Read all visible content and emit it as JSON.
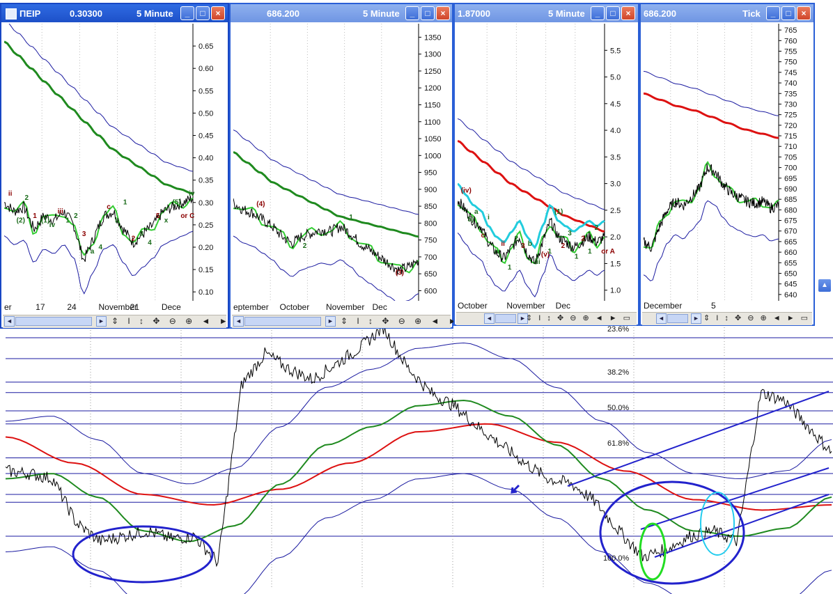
{
  "colors": {
    "blue_band": "#1a1aa0",
    "red_ma": "#dd1111",
    "green_ma": "#1f8a1f",
    "light_green": "#33cc33",
    "cyan": "#22ccdd",
    "ellipse_blue": "#2222cc",
    "ellipse_green": "#22dd22",
    "ellipse_cyan": "#22ccee",
    "title_active": "#1d50c8",
    "title_inactive": "#7aa0e8"
  },
  "windows": [
    {
      "title_left": "ПΕΙΡ",
      "title_value": "0.30300",
      "interval": "5 Minute",
      "y_ticks": [
        "0.65",
        "0.60",
        "0.55",
        "0.50",
        "0.45",
        "0.40",
        "0.35",
        "0.30",
        "0.25",
        "0.20",
        "0.15",
        "0.10"
      ],
      "x_ticks": [
        "er",
        "17",
        "24",
        "November",
        "21",
        "Dece"
      ],
      "wave_labels": [
        "ii",
        "(2)",
        "2",
        "1",
        "(1)",
        "iv",
        "iii",
        "1",
        "2",
        "3",
        "a",
        "4",
        "c",
        "b",
        "1",
        "2",
        "3",
        "4",
        "5",
        "x",
        "(5)",
        "or C",
        "iv"
      ],
      "buttons": {
        "min": "_",
        "max": "□",
        "close": "×"
      }
    },
    {
      "title_value": "686.200",
      "interval": "5 Minute",
      "y_ticks": [
        "1350",
        "1300",
        "1250",
        "1200",
        "1150",
        "1100",
        "1050",
        "1000",
        "950",
        "900",
        "850",
        "800",
        "750",
        "700",
        "650",
        "600"
      ],
      "x_ticks": [
        "eptember",
        "October",
        "November",
        "Dec"
      ],
      "wave_labels": [
        "(4)",
        "2",
        "1",
        "(3)"
      ],
      "buttons": {
        "min": "_",
        "max": "□",
        "close": "×"
      }
    },
    {
      "title_value": "1.87000",
      "interval": "5 Minute",
      "y_ticks": [
        "5.5",
        "5.0",
        "4.5",
        "4.0",
        "3.5",
        "3.0",
        "2.5",
        "2.0",
        "1.5",
        "1.0"
      ],
      "x_ticks": [
        "October",
        "November",
        "Dec"
      ],
      "wave_labels": [
        "(iv)",
        "5)",
        "a",
        "c",
        "i",
        "iv",
        "ii",
        "1",
        "2",
        "3",
        "b",
        "iii",
        "(v)",
        "1",
        "(1)",
        "2",
        "3",
        "1",
        "2",
        "1",
        "2",
        "or A"
      ],
      "buttons": {
        "min": "_",
        "max": "□",
        "close": "×"
      }
    },
    {
      "title_value": "686.200",
      "interval": "Tick",
      "y_ticks": [
        "765",
        "760",
        "755",
        "750",
        "745",
        "740",
        "735",
        "730",
        "725",
        "720",
        "715",
        "710",
        "705",
        "700",
        "695",
        "690",
        "685",
        "680",
        "675",
        "670",
        "665",
        "660",
        "655",
        "650",
        "645",
        "640"
      ],
      "x_ticks": [
        "December",
        "5"
      ],
      "buttons": {
        "min": "_",
        "max": "□",
        "close": "×"
      }
    }
  ],
  "toolbar_glyphs": "⇕ I ↕ ✥ ⊖ ⊕ ◄ ► ▭",
  "main": {
    "fib_labels": [
      "23.6%",
      "38.2%",
      "50.0%",
      "61.8%",
      "100.0%"
    ]
  },
  "chart_data": [
    {
      "type": "line",
      "title": "ПΕΙΡ 0.30300 5 Minute",
      "x": [
        "er",
        "17",
        "24",
        "November",
        "21",
        "Dece"
      ],
      "ylim": [
        0.08,
        0.7
      ],
      "y_ticks": [
        0.65,
        0.6,
        0.55,
        0.5,
        0.45,
        0.4,
        0.35,
        0.3,
        0.25,
        0.2,
        0.15,
        0.1
      ],
      "series": [
        {
          "values": [
            0.3,
            0.28,
            0.29,
            0.24,
            0.27,
            0.26,
            0.28,
            0.25,
            0.17,
            0.22,
            0.27,
            0.28,
            0.24,
            0.21,
            0.23,
            0.25,
            0.28,
            0.29,
            0.3,
            0.31
          ]
        },
        {
          "values": [
            0.66,
            0.63,
            0.6,
            0.57,
            0.54,
            0.51,
            0.48,
            0.45,
            0.42,
            0.4,
            0.38,
            0.36,
            0.34,
            0.33,
            0.32
          ]
        }
      ]
    },
    {
      "type": "line",
      "title": "686.200 5 Minute",
      "x": [
        "eptember",
        "October",
        "November",
        "Dec"
      ],
      "ylim": [
        570,
        1390
      ],
      "y_ticks": [
        1350,
        1300,
        1250,
        1200,
        1150,
        1100,
        1050,
        1000,
        950,
        900,
        850,
        800,
        750,
        700,
        650,
        600
      ],
      "series": [
        {
          "values": [
            860,
            840,
            830,
            810,
            790,
            760,
            740,
            760,
            770,
            780,
            775,
            790,
            770,
            740,
            720,
            700,
            680,
            660,
            670,
            690
          ]
        },
        {
          "values": [
            1010,
            980,
            950,
            920,
            900,
            880,
            860,
            840,
            820,
            810,
            800,
            790,
            780,
            770,
            760
          ]
        }
      ]
    },
    {
      "type": "line",
      "title": "1.87000 5 Minute",
      "x": [
        "October",
        "November",
        "Dec"
      ],
      "ylim": [
        0.8,
        6.0
      ],
      "y_ticks": [
        5.5,
        5.0,
        4.5,
        4.0,
        3.5,
        3.0,
        2.5,
        2.0,
        1.5,
        1.0
      ],
      "series": [
        {
          "values": [
            2.7,
            2.5,
            2.3,
            2.2,
            1.9,
            1.7,
            1.6,
            1.8,
            2.0,
            1.7,
            1.5,
            1.9,
            2.3,
            2.0,
            1.9,
            1.8,
            1.9,
            2.0,
            1.9,
            2.0
          ]
        },
        {
          "values": [
            3.8,
            3.6,
            3.4,
            3.2,
            3.0,
            2.85,
            2.7,
            2.55,
            2.4,
            2.3,
            2.2,
            2.1
          ]
        }
      ]
    },
    {
      "type": "line",
      "title": "686.200 Tick",
      "x": [
        "December",
        "5"
      ],
      "ylim": [
        637,
        768
      ],
      "y_ticks": [
        765,
        760,
        755,
        750,
        745,
        740,
        735,
        730,
        725,
        720,
        715,
        710,
        705,
        700,
        695,
        690,
        685,
        680,
        675,
        670,
        665,
        660,
        655,
        650,
        645,
        640
      ],
      "series": [
        {
          "values": [
            665,
            662,
            672,
            680,
            684,
            682,
            686,
            690,
            700,
            698,
            692,
            688,
            686,
            684,
            683,
            684,
            681,
            682
          ]
        },
        {
          "values": [
            735,
            732,
            729,
            727,
            724,
            721,
            718,
            716,
            714
          ]
        }
      ]
    },
    {
      "type": "line",
      "y_ticks": [
        "23.6%",
        "38.2%",
        "50.0%",
        "61.8%",
        "100.0%"
      ],
      "series": [
        {
          "values": [
            0.45,
            0.44,
            0.42,
            0.25,
            0.18,
            0.2,
            0.22,
            0.19,
            0.2,
            0.1,
            0.78,
            0.9,
            0.84,
            0.8,
            0.86,
            0.92,
            1.0,
            0.85,
            0.75,
            0.7,
            0.62,
            0.55,
            0.48,
            0.42,
            0.4,
            0.33,
            0.22,
            0.12,
            0.15,
            0.2,
            0.22,
            0.18,
            0.75,
            0.72,
            0.62,
            0.52
          ]
        },
        {
          "values": [
            0.42,
            0.44,
            0.35,
            0.22,
            0.18,
            0.24,
            0.4,
            0.55,
            0.62,
            0.7,
            0.72,
            0.66,
            0.55,
            0.42,
            0.3,
            0.22,
            0.2,
            0.23,
            0.35
          ]
        },
        {
          "values": [
            0.58,
            0.48,
            0.36,
            0.32,
            0.38,
            0.48,
            0.6,
            0.63,
            0.56,
            0.45,
            0.34,
            0.3,
            0.32
          ]
        }
      ]
    }
  ]
}
